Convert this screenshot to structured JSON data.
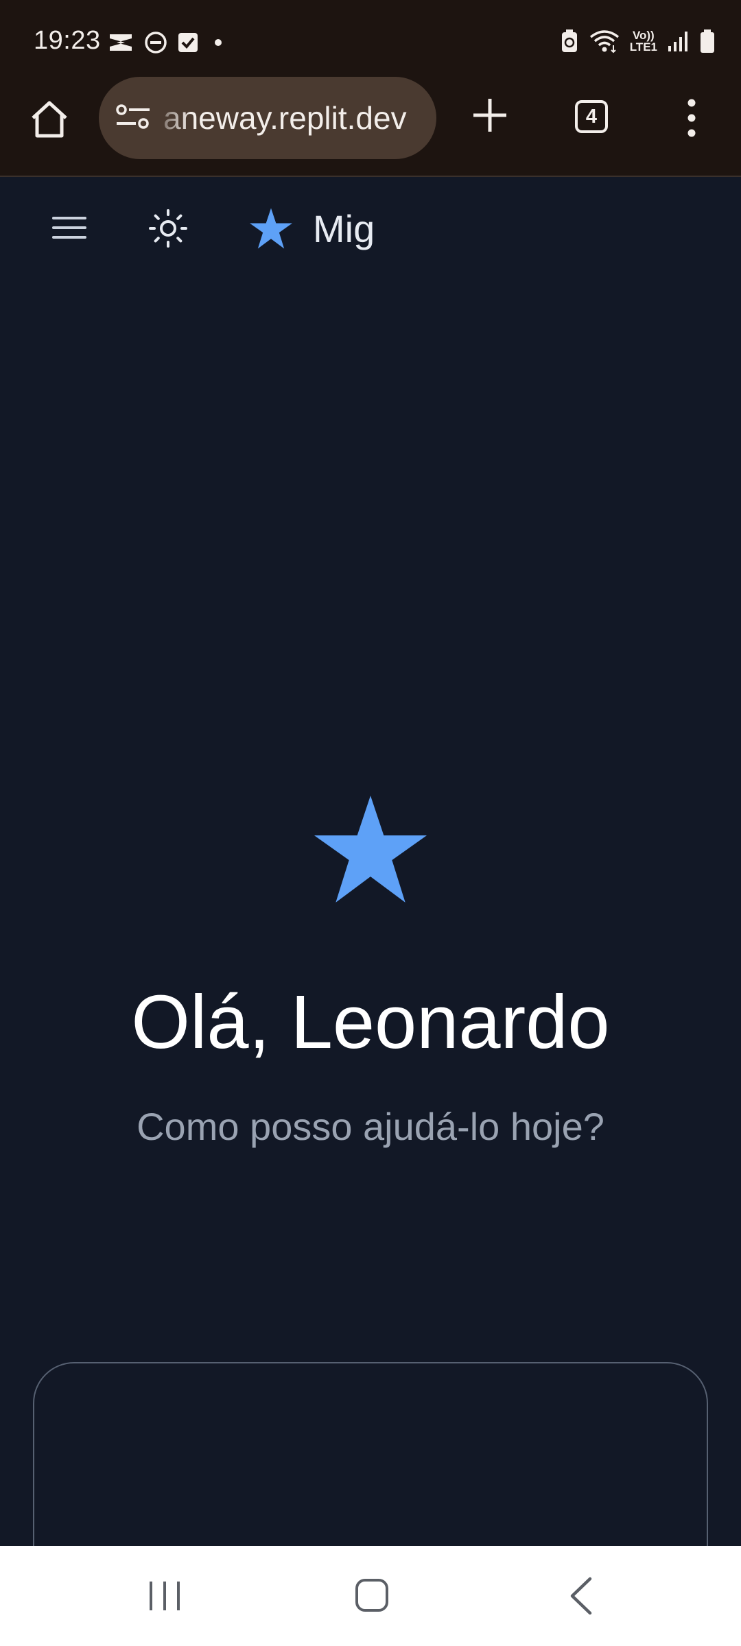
{
  "status_bar": {
    "time": "19:23",
    "icons": [
      "capcut-icon",
      "do-not-disturb-icon",
      "checkbox-icon",
      "notification-dot-icon",
      "battery-saver-icon",
      "wifi-icon",
      "volte-lte1-icon",
      "signal-icon",
      "battery-icon"
    ],
    "volte_label_top": "Vo))",
    "volte_label_bottom": "LTE1"
  },
  "browser": {
    "url": "aneway.replit.dev",
    "tab_count": "4"
  },
  "app": {
    "brand_name": "Mig",
    "greeting": "Olá, Leonardo",
    "subtitle": "Como posso ajudá-lo hoje?"
  },
  "colors": {
    "background": "#121826",
    "accent_star": "#5ea1f7",
    "chrome": "#1d1410",
    "url_pill": "#4a3a30"
  }
}
